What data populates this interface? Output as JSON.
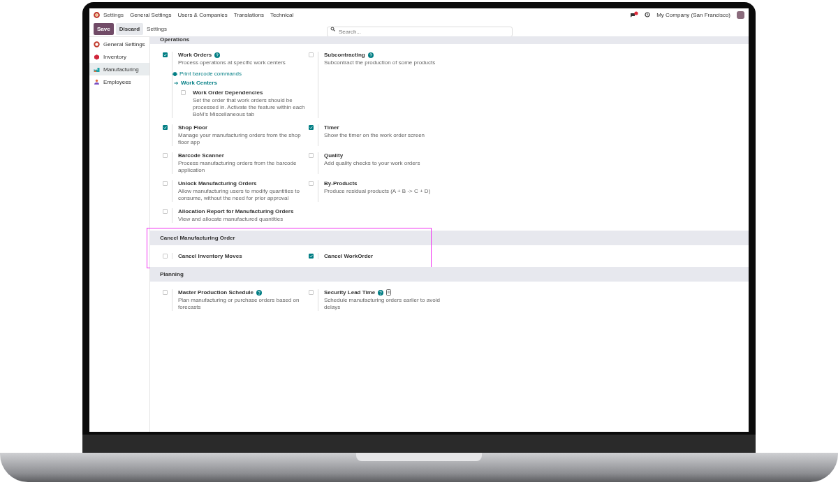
{
  "topbar": {
    "app": "Settings",
    "menu": [
      "General Settings",
      "Users & Companies",
      "Translations",
      "Technical"
    ],
    "company": "My Company (San Francisco)"
  },
  "controlbar": {
    "save": "Save",
    "discard": "Discard",
    "breadcrumb": "Settings",
    "search": {
      "placeholder": "Search..."
    }
  },
  "sidebar": {
    "items": [
      {
        "label": "General Settings",
        "selected": false
      },
      {
        "label": "Inventory",
        "selected": false
      },
      {
        "label": "Manufacturing",
        "selected": true
      },
      {
        "label": "Employees",
        "selected": false
      }
    ]
  },
  "sections": [
    {
      "title": "Operations",
      "settings": [
        {
          "title": "Work Orders",
          "help": true,
          "checked": true,
          "description": "Process operations at specific work centers",
          "links": [
            {
              "kind": "print",
              "label": "Print barcode commands"
            },
            {
              "kind": "arrow",
              "label": "Work Centers"
            }
          ],
          "children": [
            {
              "title": "Work Order Dependencies",
              "checked": false,
              "description": "Set the order that work orders should be processed in. Activate the feature within each BoM's Miscellaneous tab"
            }
          ]
        },
        {
          "title": "Subcontracting",
          "help": true,
          "checked": false,
          "description": "Subcontract the production of some products"
        },
        {
          "title": "Shop Floor",
          "checked": true,
          "description": "Manage your manufacturing orders from the shop floor app"
        },
        {
          "title": "Timer",
          "checked": true,
          "description": "Show the timer on the work order screen"
        },
        {
          "title": "Barcode Scanner",
          "checked": false,
          "description": "Process manufacturing orders from the barcode application"
        },
        {
          "title": "Quality",
          "checked": false,
          "description": "Add quality checks to your work orders"
        },
        {
          "title": "Unlock Manufacturing Orders",
          "checked": false,
          "description": "Allow manufacturing users to modify quantities to consume, without the need for prior approval"
        },
        {
          "title": "By-Products",
          "checked": false,
          "description": "Produce residual products (A + B -> C + D)"
        },
        {
          "title": "Allocation Report for Manufacturing Orders",
          "checked": false,
          "description": "View and allocate manufactured quantities"
        }
      ]
    },
    {
      "title": "Cancel Manufacturing Order",
      "highlighted": true,
      "settings": [
        {
          "title": "Cancel Inventory Moves",
          "checked": false
        },
        {
          "title": "Cancel WorkOrder",
          "checked": true
        }
      ]
    },
    {
      "title": "Planning",
      "settings": [
        {
          "title": "Master Production Schedule",
          "help": true,
          "checked": false,
          "description": "Plan manufacturing or purchase orders based on forecasts"
        },
        {
          "title": "Security Lead Time",
          "help": true,
          "mobile_note": true,
          "checked": false,
          "description": "Schedule manufacturing orders earlier to avoid delays"
        }
      ]
    }
  ]
}
